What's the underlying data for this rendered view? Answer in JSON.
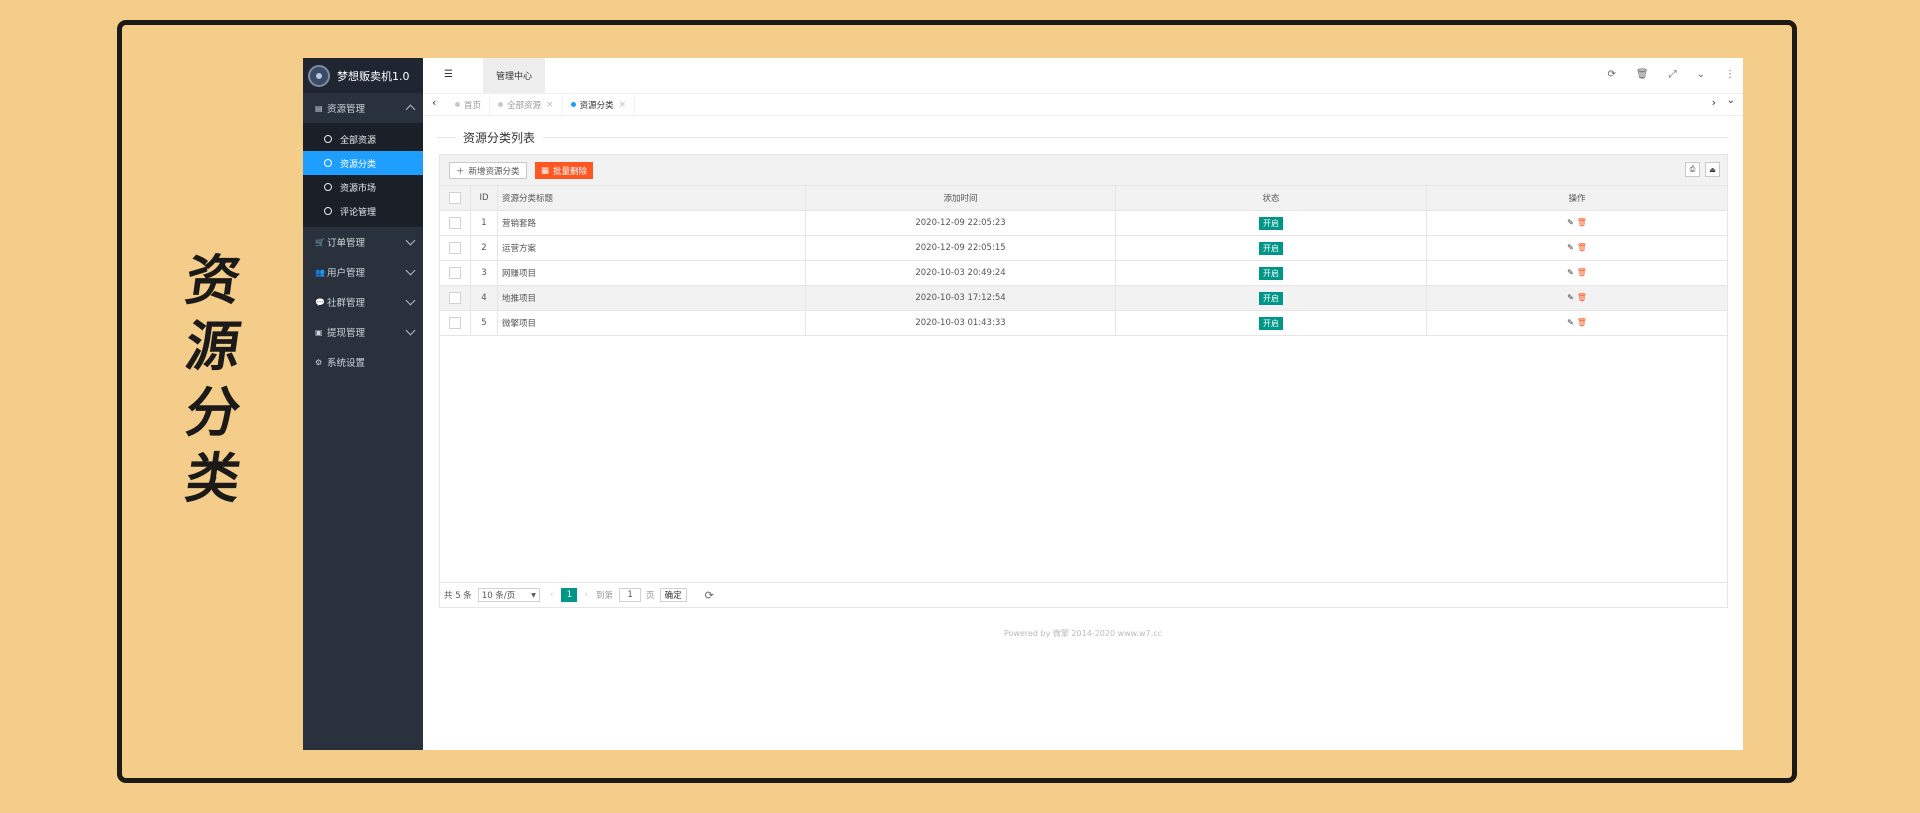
{
  "side_title": [
    "资",
    "源",
    "分",
    "类"
  ],
  "app": {
    "name": "梦想贩卖机1.0",
    "sidebar": {
      "groups": [
        {
          "icon": "book-icon",
          "label": "资源管理",
          "expanded": true,
          "items": [
            "全部资源",
            "资源分类",
            "资源市场",
            "评论管理"
          ],
          "active": "资源分类"
        },
        {
          "icon": "cart-icon",
          "label": "订单管理"
        },
        {
          "icon": "users-icon",
          "label": "用户管理"
        },
        {
          "icon": "chat-icon",
          "label": "社群管理"
        },
        {
          "icon": "cash-icon",
          "label": "提现管理"
        },
        {
          "icon": "gear-icon",
          "label": "系统设置"
        }
      ]
    },
    "topbar": {
      "tab": "管理中心",
      "icons": [
        "refresh-icon",
        "trash-icon",
        "fullscreen-icon",
        "dropdown-icon",
        "more-icon"
      ]
    },
    "page_tabs": [
      {
        "label": "首页",
        "closable": false
      },
      {
        "label": "全部资源",
        "closable": true
      },
      {
        "label": "资源分类",
        "closable": true,
        "active": true
      }
    ],
    "content": {
      "legend": "资源分类列表",
      "toolbar": {
        "add_label": "新增资源分类",
        "delete_label": "批量删除"
      },
      "table": {
        "columns": [
          "",
          "ID",
          "资源分类标题",
          "添加时间",
          "状态",
          "操作"
        ],
        "rows": [
          {
            "id": "1",
            "title": "营销套路",
            "time": "2020-12-09 22:05:23",
            "status": "开启"
          },
          {
            "id": "2",
            "title": "运营方案",
            "time": "2020-12-09 22:05:15",
            "status": "开启"
          },
          {
            "id": "3",
            "title": "网赚项目",
            "time": "2020-10-03 20:49:24",
            "status": "开启"
          },
          {
            "id": "4",
            "title": "地推项目",
            "time": "2020-10-03 17:12:54",
            "status": "开启",
            "highlighted": true
          },
          {
            "id": "5",
            "title": "微擎项目",
            "time": "2020-10-03 01:43:33",
            "status": "开启"
          }
        ]
      },
      "pager": {
        "total": "共 5 条",
        "page_size": "10 条/页",
        "current_page": "1",
        "goto_label": "到第",
        "goto_value": "1",
        "unit": "页",
        "confirm": "确定"
      },
      "footer": "Powered by 微擎 2014-2020 www.w7.cc"
    }
  },
  "colors": {
    "background": "#f4cd8a",
    "sidebar": "#28313c",
    "active_blue": "#1e9fff",
    "danger": "#ff5722",
    "success": "#009688"
  }
}
